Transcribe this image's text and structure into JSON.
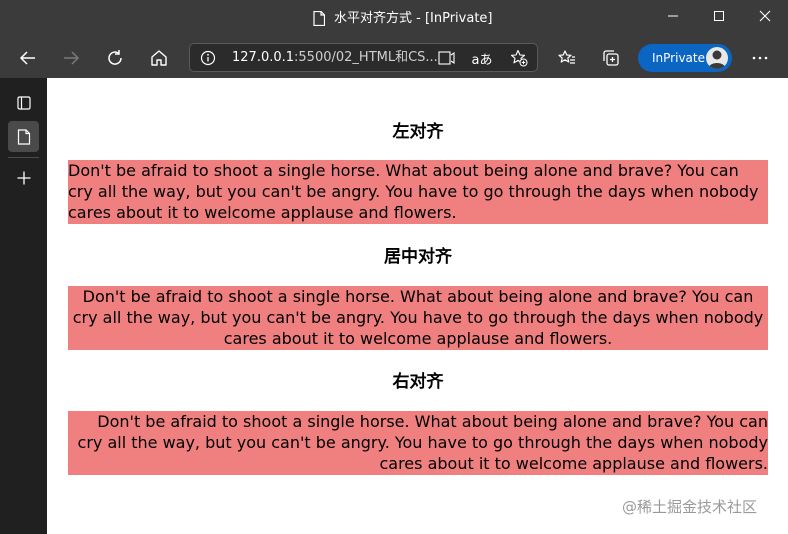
{
  "window": {
    "title": "水平对齐方式 - [InPrivate]",
    "controls": {
      "minimize_icon": "minimize-icon",
      "maximize_icon": "maximize-icon",
      "close_icon": "close-icon"
    }
  },
  "toolbar": {
    "url_host": "127.0.0.1",
    "url_rest": ":5500/02_HTML和CS...",
    "inprivate_label": "InPrivate",
    "read_aloud_label": "aあ"
  },
  "page": {
    "sections": [
      {
        "heading": "左对齐",
        "text": "Don't be afraid to shoot a single horse. What about being alone and brave? You can cry all the way, but you can't be angry. You have to go through the days when nobody cares about it to welcome applause and flowers.",
        "align": "left"
      },
      {
        "heading": "居中对齐",
        "text": "Don't be afraid to shoot a single horse. What about being alone and brave? You can cry all the way, but you can't be angry. You have to go through the days when nobody cares about it to welcome applause and flowers.",
        "align": "center"
      },
      {
        "heading": "右对齐",
        "text": "Don't be afraid to shoot a single horse. What about being alone and brave? You can cry all the way, but you can't be angry. You have to go through the days when nobody cares about it to welcome applause and flowers.",
        "align": "right"
      }
    ],
    "paragraph_bg": "#f08080"
  },
  "watermark": "@稀土掘金技术社区",
  "colors": {
    "chrome_bg": "#3b3b3b",
    "sidebar_bg": "#202020",
    "inprivate_blue": "#0a66c2"
  }
}
